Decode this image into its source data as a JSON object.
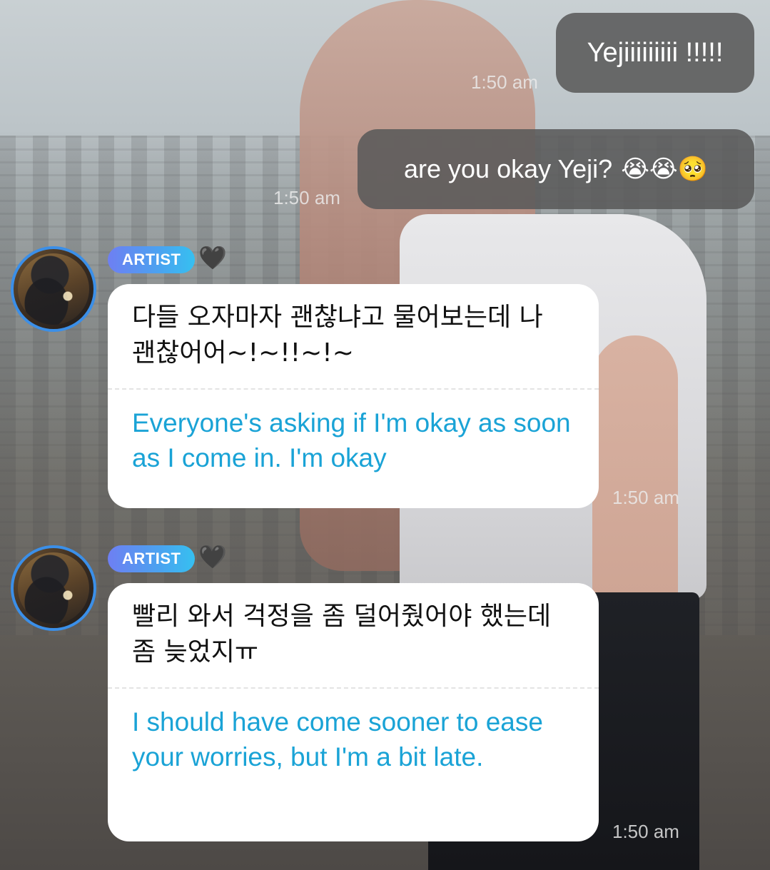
{
  "messages_out": [
    {
      "text": "Yejiiiiiiiii !!!!!",
      "time": "1:50 am"
    },
    {
      "text": "are you okay Yeji?",
      "emoji": "😭😭🥺",
      "time": "1:50 am"
    }
  ],
  "messages_in": [
    {
      "badge": "ARTIST",
      "heart": "🖤",
      "korean": "다들 오자마자 괜찮냐고 물어보는데 나 괜찮어어~!~!!~!~",
      "translation": "Everyone's asking if I'm okay as soon as I come in. I'm okay",
      "time": "1:50 am"
    },
    {
      "badge": "ARTIST",
      "heart": "🖤",
      "korean": "빨리 와서 걱정을 좀 덜어줬어야 했는데 좀 늦었지ㅠ",
      "translation": "I should have come sooner to ease your worries, but I'm a bit late.",
      "time": "1:50 am"
    }
  ],
  "colors": {
    "outgoing_bubble": "#5a5a5a",
    "translation_text": "#1aa3d6",
    "avatar_ring": "#3b8fe8",
    "badge_start": "#6e7ff2",
    "badge_end": "#36c0f0"
  },
  "icons": {
    "avatar": "artist-profile-photo",
    "heart": "black-heart-icon"
  }
}
